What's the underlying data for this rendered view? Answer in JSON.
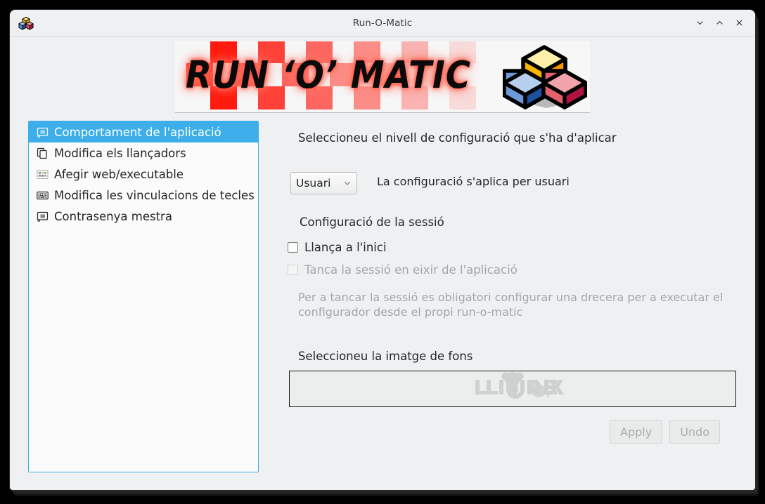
{
  "window": {
    "title": "Run-O-Matic",
    "app_icon": "cubes-icon",
    "controls": {
      "minimize": "minimize-icon",
      "maximize": "maximize-icon",
      "close": "close-icon"
    }
  },
  "banner": {
    "logo_text": "RUN ‘O’ MATIC",
    "graphic": "three-cubes-graphic",
    "accent_color": "#ff1a0f"
  },
  "sidebar": {
    "items": [
      {
        "label": "Comportament de l'aplicació",
        "icon": "window-icon",
        "selected": true
      },
      {
        "label": "Modifica els llançadors",
        "icon": "copy-pages-icon",
        "selected": false
      },
      {
        "label": "Afegir web/executable",
        "icon": "apps-grid-icon",
        "selected": false
      },
      {
        "label": "Modifica les vinculacions de tecles",
        "icon": "keyboard-icon",
        "selected": false
      },
      {
        "label": "Contrasenya mestra",
        "icon": "window-icon",
        "selected": false
      }
    ],
    "selection_color": "#3daee9"
  },
  "main": {
    "level_label": "Seleccioneu el nivell de configuració que s'ha d'aplicar",
    "level_combo": {
      "value": "Usuari",
      "options": [
        "Usuari"
      ],
      "chevron": "chevron-down-icon"
    },
    "level_note": "La configuració s'aplica per usuari",
    "session_heading": "Configuració de la sessió",
    "checkbox_startup": {
      "label": "Llança a l'inici",
      "checked": false,
      "enabled": true
    },
    "checkbox_close_session": {
      "label": "Tanca la sessió en eixir de l'aplicació",
      "checked": false,
      "enabled": false
    },
    "hint": "Per a tancar la sessió es obligatori configurar una drecera per a executar el configurador desde el propi run-o-matic",
    "background_heading": "Seleccioneu la imatge de fons",
    "background_preview": {
      "watermark": "LLIUREX",
      "icon": "lliurex-mouse-icon"
    },
    "buttons": {
      "apply": {
        "label": "Apply",
        "enabled": false
      },
      "undo": {
        "label": "Undo",
        "enabled": false
      }
    }
  }
}
